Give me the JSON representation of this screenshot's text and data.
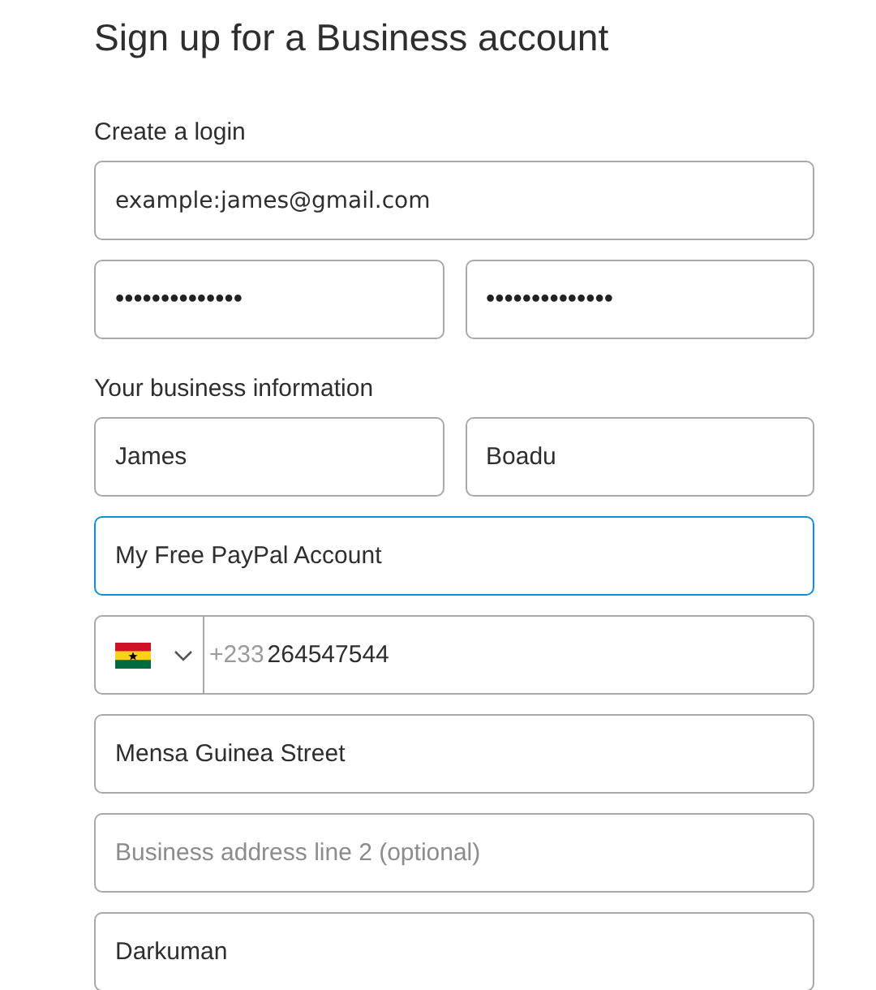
{
  "title": "Sign up for a Business account",
  "sections": [
    {
      "label": "Create a login",
      "rows": [
        [
          {
            "kind": "email",
            "value": "example:james@gmail.com",
            "focused": false
          }
        ],
        [
          {
            "kind": "password",
            "value": "••••••••••••••",
            "focused": false
          },
          {
            "kind": "password",
            "value": "••••••••••••••",
            "focused": false
          }
        ]
      ]
    },
    {
      "label": "Your business information",
      "rows": [
        [
          {
            "kind": "text",
            "value": "James",
            "focused": false
          },
          {
            "kind": "text",
            "value": "Boadu",
            "focused": false
          }
        ],
        [
          {
            "kind": "text",
            "value": "My Free PayPal Account",
            "focused": true
          }
        ],
        [
          {
            "kind": "phone",
            "code": "+233",
            "value": "264547544",
            "focused": false
          }
        ],
        [
          {
            "kind": "text",
            "value": "Mensa Guinea Street",
            "focused": false
          }
        ],
        [
          {
            "kind": "text",
            "placeholder": "Business address line 2 (optional)",
            "focused": false
          }
        ],
        [
          {
            "kind": "text",
            "value": "Darkuman",
            "focused": false
          }
        ]
      ]
    }
  ]
}
